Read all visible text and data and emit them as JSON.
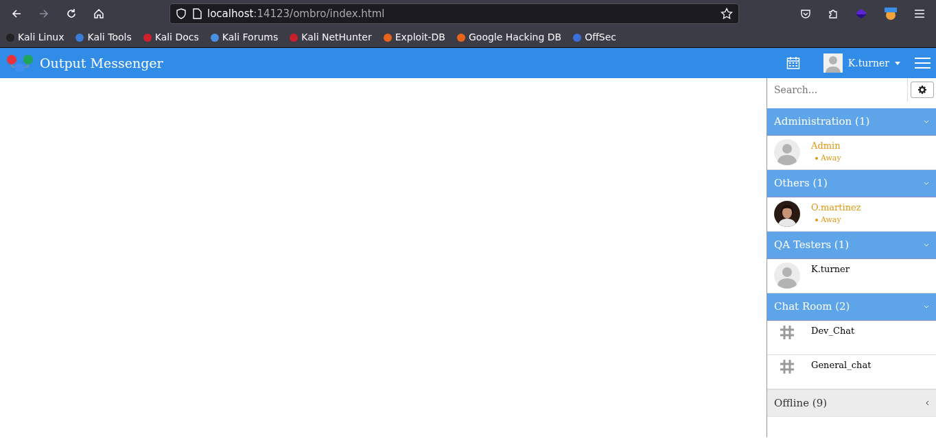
{
  "browser": {
    "url_host": "localhost",
    "url_rest": ":14123/ombro/index.html",
    "bookmarks": [
      {
        "label": "Kali Linux",
        "color": "#222222"
      },
      {
        "label": "Kali Tools",
        "color": "#3a7bd5"
      },
      {
        "label": "Kali Docs",
        "color": "#d0202a"
      },
      {
        "label": "Kali Forums",
        "color": "#4a90e2"
      },
      {
        "label": "Kali NetHunter",
        "color": "#c8202a"
      },
      {
        "label": "Exploit-DB",
        "color": "#e8641c"
      },
      {
        "label": "Google Hacking DB",
        "color": "#e8641c"
      },
      {
        "label": "OffSec",
        "color": "#3b6fd9"
      }
    ]
  },
  "app": {
    "title": "Output Messenger",
    "user": {
      "name": "K.turner"
    },
    "search": {
      "placeholder": "Search..."
    },
    "groups": [
      {
        "title": "Administration (1)",
        "expanded": true,
        "members": [
          {
            "kind": "user",
            "name": "Admin",
            "color": "#e0960e",
            "status": "Away"
          }
        ]
      },
      {
        "title": "Others (1)",
        "expanded": true,
        "members": [
          {
            "kind": "photo-user",
            "name": "O.martinez",
            "color": "#e0960e",
            "status": "Away"
          }
        ]
      },
      {
        "title": "QA Testers (1)",
        "expanded": true,
        "members": [
          {
            "kind": "user",
            "name": "K.turner",
            "color": "#000000"
          }
        ]
      },
      {
        "title": "Chat Room (2)",
        "expanded": true,
        "members": [
          {
            "kind": "room",
            "name": "Dev_Chat"
          },
          {
            "kind": "room",
            "name": "General_chat"
          }
        ]
      },
      {
        "title": "Offline (9)",
        "expanded": false
      }
    ]
  }
}
